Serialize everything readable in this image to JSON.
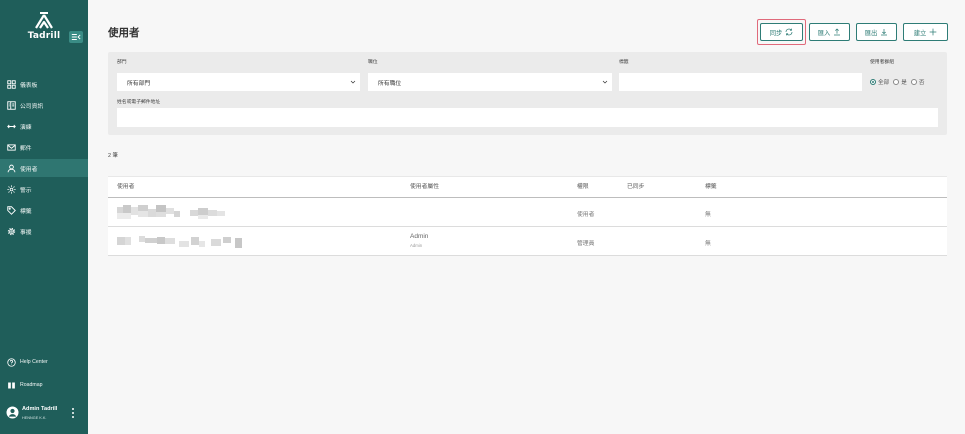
{
  "app": {
    "name": "Tadrill"
  },
  "sidebar": {
    "items": [
      {
        "label": "儀表板",
        "icon": "dashboard-icon"
      },
      {
        "label": "公司資訊",
        "icon": "building-icon"
      },
      {
        "label": "演練",
        "icon": "arrows-icon"
      },
      {
        "label": "郵件",
        "icon": "mail-icon"
      },
      {
        "label": "使用者",
        "icon": "user-icon",
        "active": true
      },
      {
        "label": "警示",
        "icon": "alert-icon"
      },
      {
        "label": "標籤",
        "icon": "tag-icon"
      },
      {
        "label": "事援",
        "icon": "gear-icon"
      }
    ],
    "footer": {
      "help_label": "Help Center",
      "roadmap_label": "Roadmap",
      "user_name": "Admin Tadrill",
      "company": "HENNGE K.K."
    }
  },
  "page": {
    "title": "使用者",
    "actions": {
      "sync": "同步",
      "import": "匯入",
      "export": "匯出",
      "create": "建立"
    }
  },
  "filters": {
    "department": {
      "label": "部門",
      "value": "所有部門"
    },
    "position": {
      "label": "職位",
      "value": "所有職位"
    },
    "tag": {
      "label": "標籤",
      "value": ""
    },
    "user_group": {
      "label": "使用者群組",
      "options": [
        "全部",
        "是",
        "否"
      ],
      "selected": "全部"
    },
    "search": {
      "label": "姓名或電子郵件地址",
      "value": ""
    }
  },
  "results": {
    "count_text": "2 筆"
  },
  "table": {
    "headers": [
      "使用者",
      "使用者屬性",
      "權限",
      "已同步",
      "標籤"
    ],
    "rows": [
      {
        "role": "使用者",
        "tags": "無"
      },
      {
        "attribute": "Admin",
        "attribute_sub": "Admin",
        "role": "管理員",
        "tags": "無"
      }
    ]
  },
  "colors": {
    "sidebar_bg": "#1f5e5a",
    "sidebar_active": "#2f7671",
    "accent": "#2e7c76",
    "highlight_frame": "#e06a7b",
    "filter_panel_bg": "#ebebeb"
  }
}
